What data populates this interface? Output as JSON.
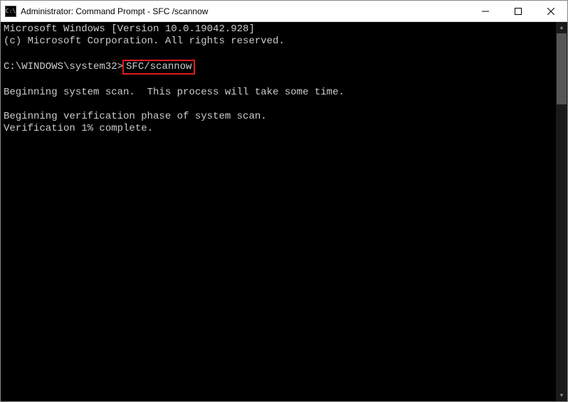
{
  "window": {
    "title": "Administrator: Command Prompt - SFC /scannow",
    "icon_text": "C:\\"
  },
  "terminal": {
    "version_line": "Microsoft Windows [Version 10.0.19042.928]",
    "copyright_line": "(c) Microsoft Corporation. All rights reserved.",
    "prompt_path": "C:\\WINDOWS\\system32>",
    "command": "SFC/scannow",
    "scan_begin": "Beginning system scan.  This process will take some time.",
    "verify_begin": "Beginning verification phase of system scan.",
    "verify_progress": "Verification 1% complete."
  }
}
